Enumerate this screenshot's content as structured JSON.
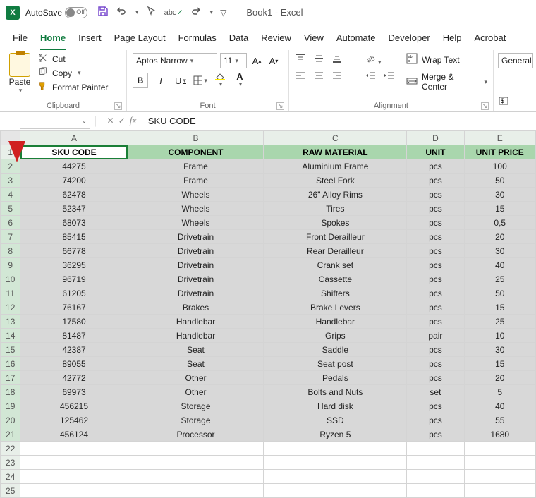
{
  "title": {
    "autosave_label": "AutoSave",
    "autosave_state": "Off",
    "doc": "Book1 - Excel"
  },
  "tabs": [
    "File",
    "Home",
    "Insert",
    "Page Layout",
    "Formulas",
    "Data",
    "Review",
    "View",
    "Automate",
    "Developer",
    "Help",
    "Acrobat"
  ],
  "active_tab": "Home",
  "clipboard": {
    "paste": "Paste",
    "cut": "Cut",
    "copy": "Copy",
    "painter": "Format Painter",
    "group": "Clipboard"
  },
  "font": {
    "name": "Aptos Narrow",
    "size": "11",
    "group": "Font"
  },
  "alignment": {
    "wrap": "Wrap Text",
    "merge": "Merge & Center",
    "group": "Alignment"
  },
  "number": {
    "format": "General"
  },
  "formula_bar": {
    "value": "SKU CODE"
  },
  "columns": [
    "A",
    "B",
    "C",
    "D",
    "E"
  ],
  "headers": {
    "A": "SKU CODE",
    "B": "COMPONENT",
    "C": "RAW MATERIAL",
    "D": "UNIT",
    "E": "UNIT PRICE"
  },
  "rows": [
    {
      "n": 2,
      "A": "44275",
      "B": "Frame",
      "C": "Aluminium Frame",
      "D": "pcs",
      "E": "100"
    },
    {
      "n": 3,
      "A": "74200",
      "B": "Frame",
      "C": "Steel Fork",
      "D": "pcs",
      "E": "50"
    },
    {
      "n": 4,
      "A": "62478",
      "B": "Wheels",
      "C": "26\" Alloy Rims",
      "D": "pcs",
      "E": "30"
    },
    {
      "n": 5,
      "A": "52347",
      "B": "Wheels",
      "C": "Tires",
      "D": "pcs",
      "E": "15"
    },
    {
      "n": 6,
      "A": "68073",
      "B": "Wheels",
      "C": "Spokes",
      "D": "pcs",
      "E": "0,5"
    },
    {
      "n": 7,
      "A": "85415",
      "B": "Drivetrain",
      "C": "Front Derailleur",
      "D": "pcs",
      "E": "20"
    },
    {
      "n": 8,
      "A": "66778",
      "B": "Drivetrain",
      "C": "Rear Derailleur",
      "D": "pcs",
      "E": "30"
    },
    {
      "n": 9,
      "A": "36295",
      "B": "Drivetrain",
      "C": "Crank set",
      "D": "pcs",
      "E": "40"
    },
    {
      "n": 10,
      "A": "96719",
      "B": "Drivetrain",
      "C": "Cassette",
      "D": "pcs",
      "E": "25"
    },
    {
      "n": 11,
      "A": "61205",
      "B": "Drivetrain",
      "C": "Shifters",
      "D": "pcs",
      "E": "50"
    },
    {
      "n": 12,
      "A": "76167",
      "B": "Brakes",
      "C": "Brake Levers",
      "D": "pcs",
      "E": "15"
    },
    {
      "n": 13,
      "A": "17580",
      "B": "Handlebar",
      "C": "Handlebar",
      "D": "pcs",
      "E": "25"
    },
    {
      "n": 14,
      "A": "81487",
      "B": "Handlebar",
      "C": "Grips",
      "D": "pair",
      "E": "10"
    },
    {
      "n": 15,
      "A": "42387",
      "B": "Seat",
      "C": "Saddle",
      "D": "pcs",
      "E": "30"
    },
    {
      "n": 16,
      "A": "89055",
      "B": "Seat",
      "C": "Seat post",
      "D": "pcs",
      "E": "15"
    },
    {
      "n": 17,
      "A": "42772",
      "B": "Other",
      "C": "Pedals",
      "D": "pcs",
      "E": "20"
    },
    {
      "n": 18,
      "A": "69973",
      "B": "Other",
      "C": "Bolts and Nuts",
      "D": "set",
      "E": "5"
    },
    {
      "n": 19,
      "A": "456215",
      "B": "Storage",
      "C": "Hard disk",
      "D": "pcs",
      "E": "40"
    },
    {
      "n": 20,
      "A": "125462",
      "B": "Storage",
      "C": "SSD",
      "D": "pcs",
      "E": "55"
    },
    {
      "n": 21,
      "A": "456124",
      "B": "Processor",
      "C": "Ryzen 5",
      "D": "pcs",
      "E": "1680"
    }
  ],
  "chart_data": {
    "type": "table",
    "title": "Book1 - Excel",
    "columns": [
      "SKU CODE",
      "COMPONENT",
      "RAW MATERIAL",
      "UNIT",
      "UNIT PRICE"
    ],
    "rows": [
      [
        "44275",
        "Frame",
        "Aluminium Frame",
        "pcs",
        100
      ],
      [
        "74200",
        "Frame",
        "Steel Fork",
        "pcs",
        50
      ],
      [
        "62478",
        "Wheels",
        "26\" Alloy Rims",
        "pcs",
        30
      ],
      [
        "52347",
        "Wheels",
        "Tires",
        "pcs",
        15
      ],
      [
        "68073",
        "Wheels",
        "Spokes",
        "pcs",
        0.5
      ],
      [
        "85415",
        "Drivetrain",
        "Front Derailleur",
        "pcs",
        20
      ],
      [
        "66778",
        "Drivetrain",
        "Rear Derailleur",
        "pcs",
        30
      ],
      [
        "36295",
        "Drivetrain",
        "Crank set",
        "pcs",
        40
      ],
      [
        "96719",
        "Drivetrain",
        "Cassette",
        "pcs",
        25
      ],
      [
        "61205",
        "Drivetrain",
        "Shifters",
        "pcs",
        50
      ],
      [
        "76167",
        "Brakes",
        "Brake Levers",
        "pcs",
        15
      ],
      [
        "17580",
        "Handlebar",
        "Handlebar",
        "pcs",
        25
      ],
      [
        "81487",
        "Handlebar",
        "Grips",
        "pair",
        10
      ],
      [
        "42387",
        "Seat",
        "Saddle",
        "pcs",
        30
      ],
      [
        "89055",
        "Seat",
        "Seat post",
        "pcs",
        15
      ],
      [
        "42772",
        "Other",
        "Pedals",
        "pcs",
        20
      ],
      [
        "69973",
        "Other",
        "Bolts and Nuts",
        "set",
        5
      ],
      [
        "456215",
        "Storage",
        "Hard disk",
        "pcs",
        40
      ],
      [
        "125462",
        "Storage",
        "SSD",
        "pcs",
        55
      ],
      [
        "456124",
        "Processor",
        "Ryzen 5",
        "pcs",
        1680
      ]
    ]
  }
}
